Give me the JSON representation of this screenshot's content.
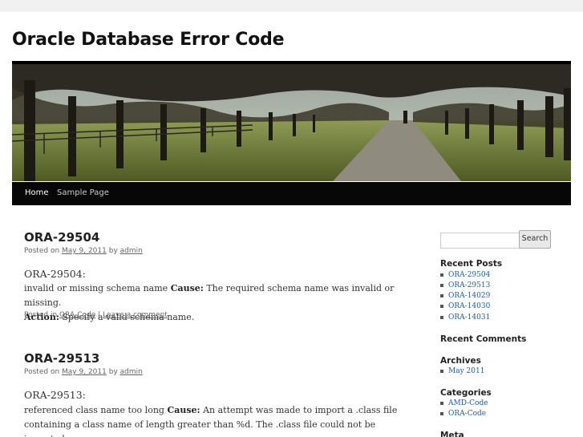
{
  "site": {
    "title": "Oracle Database Error Code"
  },
  "nav": {
    "items": [
      "Home",
      "Sample Page"
    ]
  },
  "posts": [
    {
      "title": "ORA-29504",
      "posted_on": "Posted on",
      "date": "May 9, 2011",
      "by": "by",
      "author": "admin",
      "code": "ORA-29504:",
      "text": "invalid or missing schema name",
      "cause_label": "Cause:",
      "cause": "The required schema name was invalid or missing.",
      "action_label": "Action:",
      "action": "Specify a valid schema name.",
      "posted_in": "Posted in",
      "category": "ORA-Code",
      "sep": "|",
      "comment_link": "Leave a comment"
    },
    {
      "title": "ORA-29513",
      "posted_on": "Posted on",
      "date": "May 9, 2011",
      "by": "by",
      "author": "admin",
      "code": "ORA-29513:",
      "text": "referenced class name too long",
      "cause_label": "Cause:",
      "cause_line1": "An attempt was made to import a .class file",
      "cause_line2": "containing a class name of length greater than %d. The .class file could not be imported"
    }
  ],
  "sidebar": {
    "search_button": "Search",
    "recent_posts_title": "Recent Posts",
    "recent_posts": [
      "ORA-29504",
      "ORA-29513",
      "ORA-14029",
      "ORA-14030",
      "ORA-14031"
    ],
    "recent_comments_title": "Recent Comments",
    "archives_title": "Archives",
    "archives": [
      "May 2011"
    ],
    "categories_title": "Categories",
    "categories": [
      "AMD-Code",
      "ORA-Code"
    ],
    "meta_title": "Meta"
  }
}
